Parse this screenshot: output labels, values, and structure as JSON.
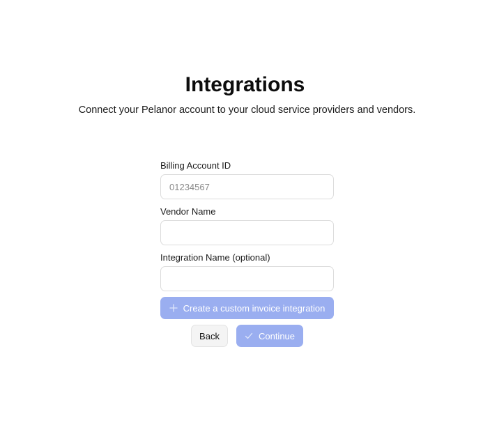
{
  "header": {
    "title": "Integrations",
    "subtitle": "Connect your Pelanor account to your cloud service providers and vendors."
  },
  "form": {
    "billing_account_id": {
      "label": "Billing Account ID",
      "placeholder": "01234567",
      "value": ""
    },
    "vendor_name": {
      "label": "Vendor Name",
      "placeholder": "",
      "value": ""
    },
    "integration_name": {
      "label": "Integration Name (optional)",
      "placeholder": "",
      "value": ""
    }
  },
  "actions": {
    "custom_integration_label": "Create a custom invoice integration",
    "custom_integration_icon": "plus-icon",
    "back_label": "Back",
    "continue_label": "Continue",
    "continue_icon": "check-icon"
  },
  "colors": {
    "primary_disabled": "#9aaef0",
    "secondary_bg": "#f4f4f4",
    "input_border": "#dcdcdc"
  }
}
